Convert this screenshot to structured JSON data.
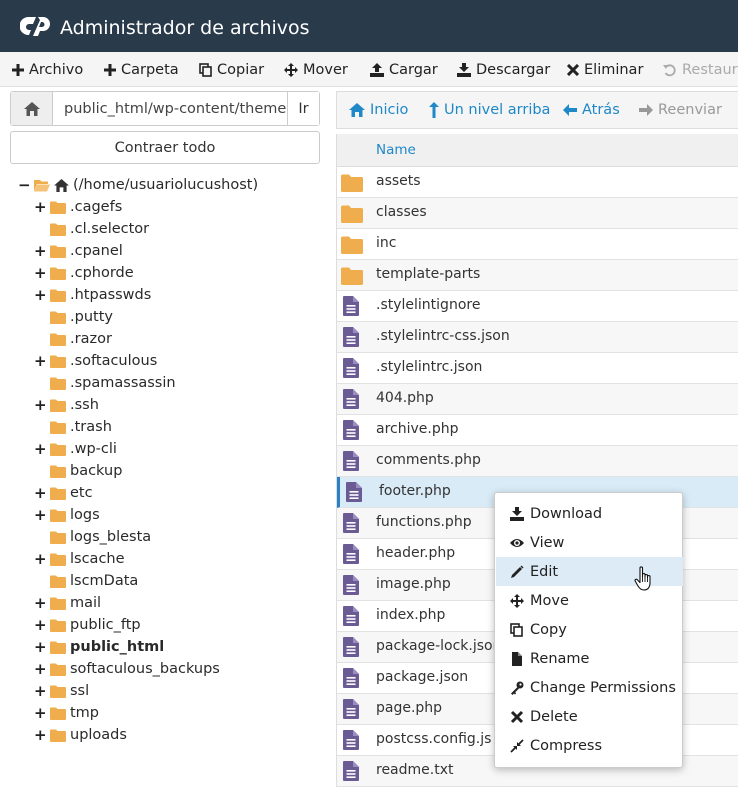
{
  "header": {
    "title": "Administrador de archivos",
    "logo_icon": "cpanel-logo-icon"
  },
  "toolbar": {
    "file": "Archivo",
    "folder": "Carpeta",
    "copy": "Copiar",
    "move": "Mover",
    "upload": "Cargar",
    "download": "Descargar",
    "delete": "Eliminar",
    "restore": "Restaura"
  },
  "pathbar": {
    "path": "public_html/wp-content/themes",
    "go": "Ir"
  },
  "collapse_all": "Contraer todo",
  "tree": {
    "root": "(/home/usuariolucushost)",
    "items": [
      ".cagefs",
      ".cl.selector",
      ".cpanel",
      ".cphorde",
      ".htpasswds",
      ".putty",
      ".razor",
      ".softaculous",
      ".spamassassin",
      ".ssh",
      ".trash",
      ".wp-cli",
      "backup",
      "etc",
      "logs",
      "logs_blesta",
      "lscache",
      "lscmData",
      "mail",
      "public_ftp",
      "public_html",
      "softaculous_backups",
      "ssl",
      "tmp",
      "uploads"
    ]
  },
  "nav": {
    "home": "Inicio",
    "up": "Un nivel arriba",
    "back": "Atrás",
    "forward": "Reenviar"
  },
  "table": {
    "name_header": "Name",
    "rows": [
      "assets",
      "classes",
      "inc",
      "template-parts",
      ".stylelintignore",
      ".stylelintrc-css.json",
      ".stylelintrc.json",
      "404.php",
      "archive.php",
      "comments.php",
      "footer.php",
      "functions.php",
      "header.php",
      "image.php",
      "index.php",
      "package-lock.json",
      "package.json",
      "page.php",
      "postcss.config.js",
      "readme.txt"
    ],
    "selected": "footer.php"
  },
  "context_menu": {
    "items": [
      "Download",
      "View",
      "Edit",
      "Move",
      "Copy",
      "Rename",
      "Change Permissions",
      "Delete",
      "Compress"
    ],
    "hovered": "Edit"
  },
  "colors": {
    "header_bg": "#293a4a",
    "link": "#1e88c8",
    "folder": "#f0ad4e",
    "file_icon": "#6b5b95",
    "selected_row": "#d9ebf7",
    "menu_hover": "#ddebf6"
  }
}
